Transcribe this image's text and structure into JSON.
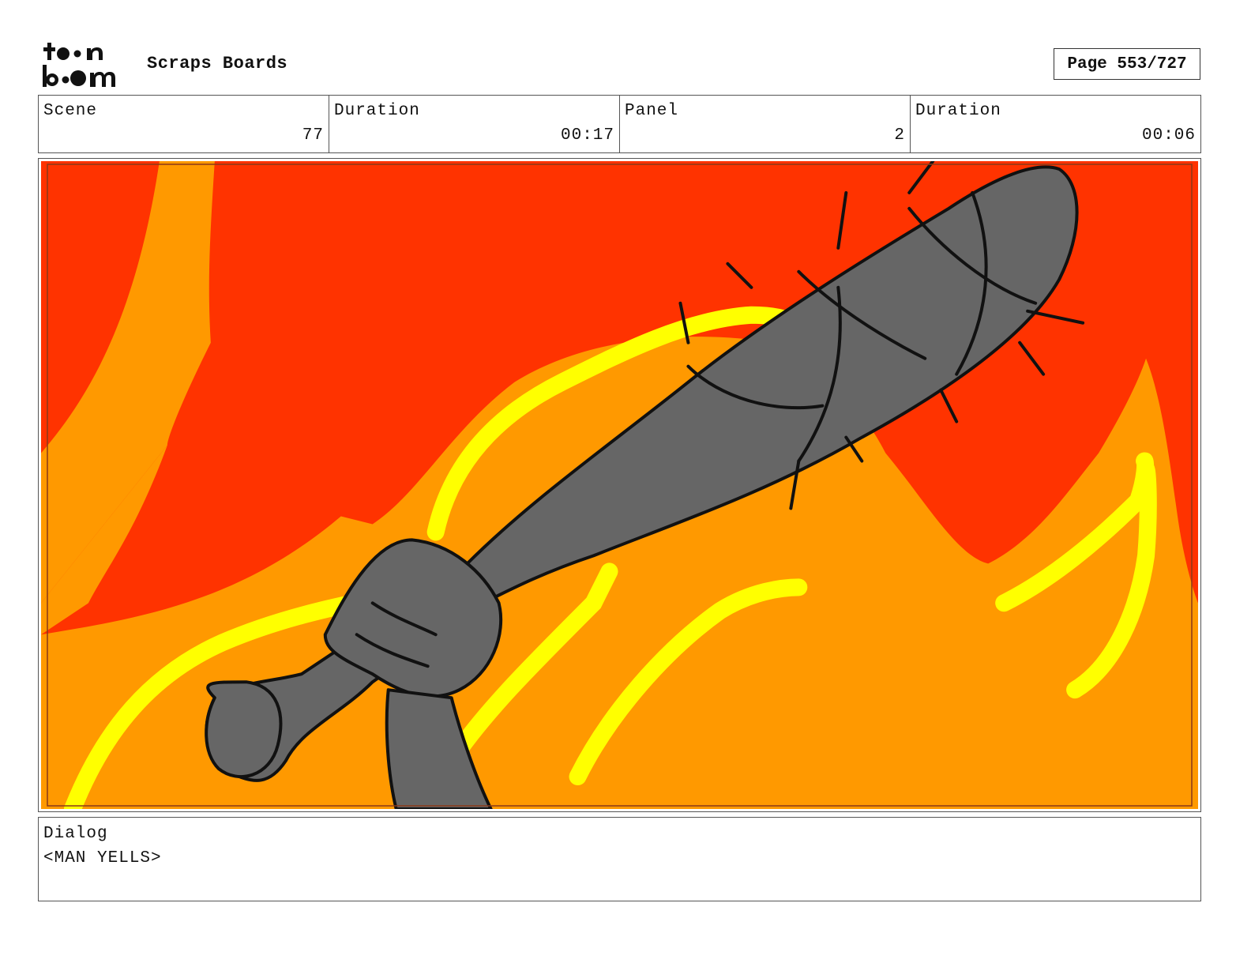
{
  "header": {
    "logo_text": "toon boom",
    "title": "Scraps Boards",
    "page_indicator": "Page 553/727"
  },
  "info": {
    "scene_label": "Scene",
    "scene_value": "77",
    "scene_duration_label": "Duration",
    "scene_duration_value": "00:17",
    "panel_label": "Panel",
    "panel_value": "2",
    "panel_duration_label": "Duration",
    "panel_duration_value": "00:06"
  },
  "panel": {
    "colors": {
      "red": "#ff3300",
      "orange": "#ff9900",
      "yellow": "#ffff00",
      "bat_gray": "#666666",
      "outline": "#111111"
    }
  },
  "dialog": {
    "label": "Dialog",
    "text": "<MAN YELLS>"
  }
}
